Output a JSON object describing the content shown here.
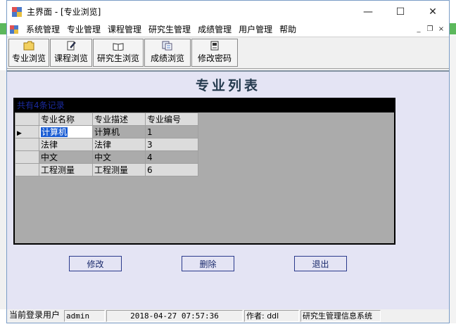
{
  "window": {
    "title": "主界面 - [专业浏览]",
    "controls": {
      "minimize": "—",
      "maximize": "☐",
      "close": "✕"
    }
  },
  "menu": {
    "items": [
      "系统管理",
      "专业管理",
      "课程管理",
      "研究生管理",
      "成绩管理",
      "用户管理",
      "帮助"
    ],
    "mdi": {
      "minimize": "_",
      "restore": "❐",
      "close": "×"
    }
  },
  "toolbar": {
    "buttons": [
      {
        "label": "专业浏览",
        "icon": "folder-icon"
      },
      {
        "label": "课程浏览",
        "icon": "document-edit-icon"
      },
      {
        "label": "研究生浏览",
        "icon": "book-icon"
      },
      {
        "label": "成绩浏览",
        "icon": "documents-icon"
      },
      {
        "label": "修改密码",
        "icon": "key-icon"
      }
    ]
  },
  "content": {
    "heading": "专业列表",
    "grid": {
      "caption": "共有4条记录",
      "columns": [
        "专业名称",
        "专业描述",
        "专业编号"
      ],
      "rows": [
        [
          "计算机",
          "计算机",
          "1"
        ],
        [
          "法律",
          "法律",
          "3"
        ],
        [
          "中文",
          "中文",
          "4"
        ],
        [
          "工程测量",
          "工程测量",
          "6"
        ]
      ],
      "current_row_marker": "▶"
    },
    "buttons": {
      "edit": "修改",
      "delete": "删除",
      "exit": "退出"
    }
  },
  "statusbar": {
    "login_label": "当前登录用户",
    "user": "admin",
    "datetime": "2018-04-27 07:57:36",
    "author": "作者: ddl",
    "system": "研究生管理信息系统"
  },
  "colors": {
    "panel_bg": "#e4e4f4",
    "heading": "#243a4e",
    "caption_bg": "#000000",
    "caption_text": "#1a2a9c",
    "selection": "#1c5ed4"
  }
}
